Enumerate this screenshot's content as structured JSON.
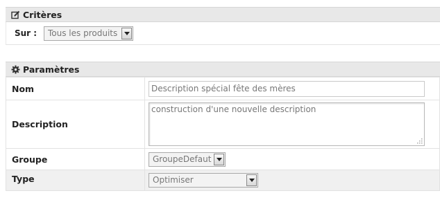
{
  "criteria": {
    "title": "Critères",
    "title_icon": "edit-icon",
    "sur_label": "Sur :",
    "sur_value": "Tous les produits"
  },
  "params": {
    "title": "Paramètres",
    "title_icon": "gear-icon",
    "nom_label": "Nom",
    "nom_value": "Description spécial fête des mères",
    "description_label": "Description",
    "description_value": "construction d'une nouvelle description",
    "groupe_label": "Groupe",
    "groupe_value": "GroupeDefaut",
    "type_label": "Type",
    "type_value": "Optimiser"
  }
}
